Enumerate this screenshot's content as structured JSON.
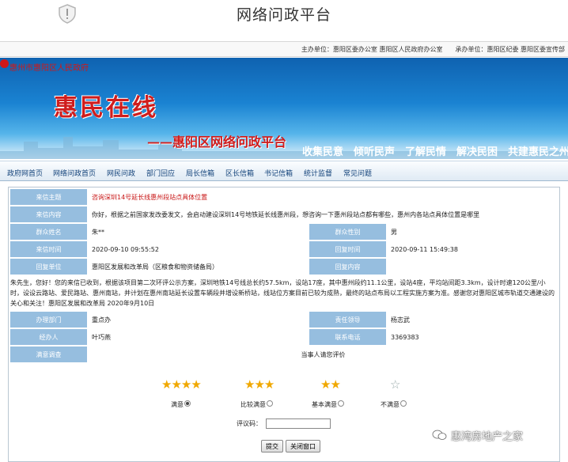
{
  "browser": {
    "title": "网络问政平台",
    "icon": "shield-icon"
  },
  "sponsor": "主办单位：惠阳区委办公室 惠阳区人民政府办公室　　承办单位：惠阳区纪委 惠阳区委宣传部",
  "banner": {
    "government": "惠州市惠阳区人民政府",
    "brand": "惠民在线",
    "subtitle": "——惠阳区网络问政平台",
    "slogan": "收集民意　倾听民声　了解民情　解决民困　共建惠民之州"
  },
  "nav": [
    "政府网首页",
    "网络问政首页",
    "网民问政",
    "部门回应",
    "局长信箱",
    "区长信箱",
    "书记信箱",
    "统计监督",
    "常见问题"
  ],
  "record": {
    "subject_label": "来信主题",
    "subject": "咨询深圳14号延长线惠州段站点具体位置",
    "content_label": "来信内容",
    "content": "你好，根据之前国家发改委发文，会启动建设深圳14号地铁延长线惠州段，想咨询一下惠州段站点都有哪些，惠州内各站点具体位置是哪里",
    "name_label": "群众姓名",
    "name": "朱**",
    "gender_label": "群众性别",
    "gender": "男",
    "time_label": "来信时间",
    "time": "2020-09-10 09:55:52",
    "reply_time_label": "回复时间",
    "reply_time": "2020-09-11 15:49:38",
    "dept_label": "回复单位",
    "dept": "惠阳区发展和改革局（区粮食和物资储备局）",
    "reply_content_label": "回复内容",
    "reply_content": "",
    "reply": "朱先生，您好！您的来信已收到，根据该项目第二次环评公示方案，深圳地铁14号线总长约57.5km，设站17座，其中惠州段约11.1公里，设站4座，平均站间距3.3km，设计时速120公里/小时，设设云路站、爱民路站、惠州南站，并计划在惠州南站延长设置车辆段并增设新桥站，线站位方案目前已较为成熟，最终的站点布局以工程实施方案为准。感谢您对惠阳区城市轨道交通建设的关心和关注！惠阳区发展和改革局 2020年9月10日",
    "handle_dept_label": "办理部门",
    "handle_dept": "重点办",
    "leader_label": "责任领导",
    "leader": "杨志武",
    "handler_label": "经办人",
    "handler": "叶巧燕",
    "phone_label": "联系电话",
    "phone": "3369383",
    "survey_label": "满意调查",
    "survey": "当事人请您评价"
  },
  "evaluation": {
    "options": [
      {
        "stars": "★★★★",
        "label": "满意",
        "selected": true
      },
      {
        "stars": "★★★",
        "label": "比较满意",
        "selected": false
      },
      {
        "stars": "★★",
        "label": "基本满意",
        "selected": false
      },
      {
        "stars": "☆",
        "label": "不满意",
        "selected": false
      }
    ],
    "code_label": "评议码：",
    "code_value": "",
    "submit": "提交",
    "close": "关闭窗口"
  },
  "watermark": "惠湾房地产之家",
  "colors": {
    "label_bg": "#96bedf",
    "brand_red": "#cf1d1d",
    "banner_blue": "#1a83d2"
  }
}
